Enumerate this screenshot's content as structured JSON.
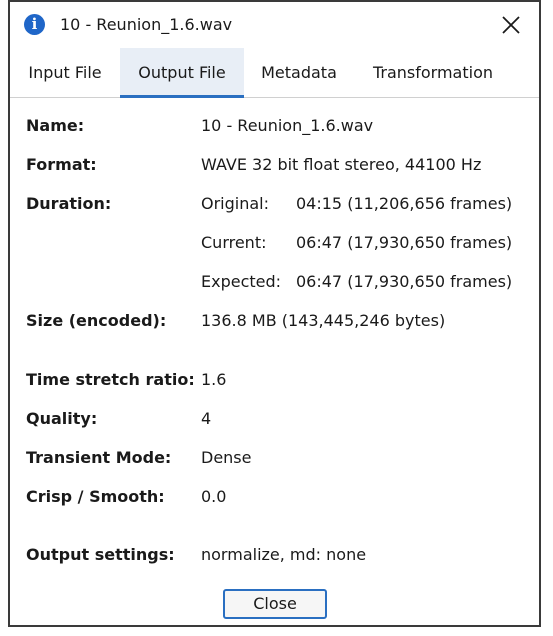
{
  "window": {
    "title": "10 - Reunion_1.6.wav",
    "icon": "info-icon"
  },
  "tabs": [
    {
      "label": "Input File"
    },
    {
      "label": "Output File"
    },
    {
      "label": "Metadata"
    },
    {
      "label": "Transformation"
    }
  ],
  "active_tab": "Output File",
  "fields": {
    "name": {
      "label": "Name:",
      "value": "10 - Reunion_1.6.wav"
    },
    "format": {
      "label": "Format:",
      "value": "WAVE 32 bit float stereo, 44100 Hz"
    },
    "duration": {
      "label": "Duration:",
      "original_label": "Original:",
      "original_value": "04:15 (11,206,656 frames)",
      "current_label": "Current:",
      "current_value": "06:47 (17,930,650 frames)",
      "expected_label": "Expected:",
      "expected_value": "06:47 (17,930,650 frames)"
    },
    "size": {
      "label": "Size (encoded):",
      "value": "136.8 MB (143,445,246 bytes)"
    },
    "time_stretch": {
      "label": "Time stretch ratio:",
      "value": "1.6"
    },
    "quality": {
      "label": "Quality:",
      "value": "4"
    },
    "transient_mode": {
      "label": "Transient Mode:",
      "value": "Dense"
    },
    "crisp_smooth": {
      "label": "Crisp / Smooth:",
      "value": "0.0"
    },
    "output_settings": {
      "label": "Output settings:",
      "value": "normalize, md: none"
    }
  },
  "buttons": {
    "close_label": "Close"
  },
  "colors": {
    "accent": "#2a6fc1",
    "info_icon": "#1f66c8",
    "active_tab_bg": "#e8eef6"
  }
}
